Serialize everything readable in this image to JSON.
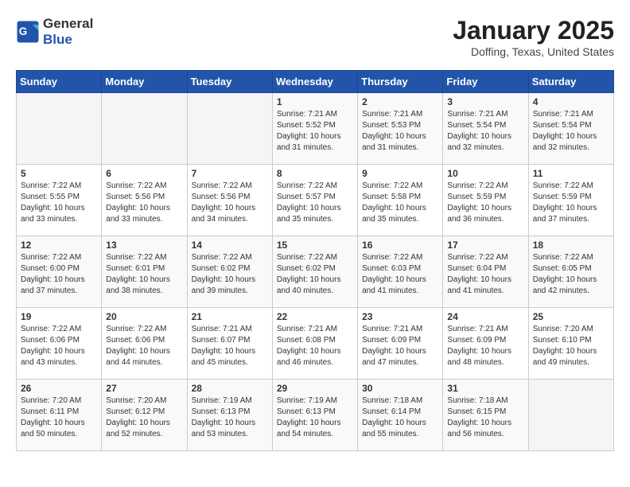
{
  "header": {
    "logo_general": "General",
    "logo_blue": "Blue",
    "title": "January 2025",
    "subtitle": "Doffing, Texas, United States"
  },
  "calendar": {
    "days_of_week": [
      "Sunday",
      "Monday",
      "Tuesday",
      "Wednesday",
      "Thursday",
      "Friday",
      "Saturday"
    ],
    "weeks": [
      [
        {
          "day": "",
          "sunrise": "",
          "sunset": "",
          "daylight": ""
        },
        {
          "day": "",
          "sunrise": "",
          "sunset": "",
          "daylight": ""
        },
        {
          "day": "",
          "sunrise": "",
          "sunset": "",
          "daylight": ""
        },
        {
          "day": "1",
          "sunrise": "Sunrise: 7:21 AM",
          "sunset": "Sunset: 5:52 PM",
          "daylight": "Daylight: 10 hours and 31 minutes."
        },
        {
          "day": "2",
          "sunrise": "Sunrise: 7:21 AM",
          "sunset": "Sunset: 5:53 PM",
          "daylight": "Daylight: 10 hours and 31 minutes."
        },
        {
          "day": "3",
          "sunrise": "Sunrise: 7:21 AM",
          "sunset": "Sunset: 5:54 PM",
          "daylight": "Daylight: 10 hours and 32 minutes."
        },
        {
          "day": "4",
          "sunrise": "Sunrise: 7:21 AM",
          "sunset": "Sunset: 5:54 PM",
          "daylight": "Daylight: 10 hours and 32 minutes."
        }
      ],
      [
        {
          "day": "5",
          "sunrise": "Sunrise: 7:22 AM",
          "sunset": "Sunset: 5:55 PM",
          "daylight": "Daylight: 10 hours and 33 minutes."
        },
        {
          "day": "6",
          "sunrise": "Sunrise: 7:22 AM",
          "sunset": "Sunset: 5:56 PM",
          "daylight": "Daylight: 10 hours and 33 minutes."
        },
        {
          "day": "7",
          "sunrise": "Sunrise: 7:22 AM",
          "sunset": "Sunset: 5:56 PM",
          "daylight": "Daylight: 10 hours and 34 minutes."
        },
        {
          "day": "8",
          "sunrise": "Sunrise: 7:22 AM",
          "sunset": "Sunset: 5:57 PM",
          "daylight": "Daylight: 10 hours and 35 minutes."
        },
        {
          "day": "9",
          "sunrise": "Sunrise: 7:22 AM",
          "sunset": "Sunset: 5:58 PM",
          "daylight": "Daylight: 10 hours and 35 minutes."
        },
        {
          "day": "10",
          "sunrise": "Sunrise: 7:22 AM",
          "sunset": "Sunset: 5:59 PM",
          "daylight": "Daylight: 10 hours and 36 minutes."
        },
        {
          "day": "11",
          "sunrise": "Sunrise: 7:22 AM",
          "sunset": "Sunset: 5:59 PM",
          "daylight": "Daylight: 10 hours and 37 minutes."
        }
      ],
      [
        {
          "day": "12",
          "sunrise": "Sunrise: 7:22 AM",
          "sunset": "Sunset: 6:00 PM",
          "daylight": "Daylight: 10 hours and 37 minutes."
        },
        {
          "day": "13",
          "sunrise": "Sunrise: 7:22 AM",
          "sunset": "Sunset: 6:01 PM",
          "daylight": "Daylight: 10 hours and 38 minutes."
        },
        {
          "day": "14",
          "sunrise": "Sunrise: 7:22 AM",
          "sunset": "Sunset: 6:02 PM",
          "daylight": "Daylight: 10 hours and 39 minutes."
        },
        {
          "day": "15",
          "sunrise": "Sunrise: 7:22 AM",
          "sunset": "Sunset: 6:02 PM",
          "daylight": "Daylight: 10 hours and 40 minutes."
        },
        {
          "day": "16",
          "sunrise": "Sunrise: 7:22 AM",
          "sunset": "Sunset: 6:03 PM",
          "daylight": "Daylight: 10 hours and 41 minutes."
        },
        {
          "day": "17",
          "sunrise": "Sunrise: 7:22 AM",
          "sunset": "Sunset: 6:04 PM",
          "daylight": "Daylight: 10 hours and 41 minutes."
        },
        {
          "day": "18",
          "sunrise": "Sunrise: 7:22 AM",
          "sunset": "Sunset: 6:05 PM",
          "daylight": "Daylight: 10 hours and 42 minutes."
        }
      ],
      [
        {
          "day": "19",
          "sunrise": "Sunrise: 7:22 AM",
          "sunset": "Sunset: 6:06 PM",
          "daylight": "Daylight: 10 hours and 43 minutes."
        },
        {
          "day": "20",
          "sunrise": "Sunrise: 7:22 AM",
          "sunset": "Sunset: 6:06 PM",
          "daylight": "Daylight: 10 hours and 44 minutes."
        },
        {
          "day": "21",
          "sunrise": "Sunrise: 7:21 AM",
          "sunset": "Sunset: 6:07 PM",
          "daylight": "Daylight: 10 hours and 45 minutes."
        },
        {
          "day": "22",
          "sunrise": "Sunrise: 7:21 AM",
          "sunset": "Sunset: 6:08 PM",
          "daylight": "Daylight: 10 hours and 46 minutes."
        },
        {
          "day": "23",
          "sunrise": "Sunrise: 7:21 AM",
          "sunset": "Sunset: 6:09 PM",
          "daylight": "Daylight: 10 hours and 47 minutes."
        },
        {
          "day": "24",
          "sunrise": "Sunrise: 7:21 AM",
          "sunset": "Sunset: 6:09 PM",
          "daylight": "Daylight: 10 hours and 48 minutes."
        },
        {
          "day": "25",
          "sunrise": "Sunrise: 7:20 AM",
          "sunset": "Sunset: 6:10 PM",
          "daylight": "Daylight: 10 hours and 49 minutes."
        }
      ],
      [
        {
          "day": "26",
          "sunrise": "Sunrise: 7:20 AM",
          "sunset": "Sunset: 6:11 PM",
          "daylight": "Daylight: 10 hours and 50 minutes."
        },
        {
          "day": "27",
          "sunrise": "Sunrise: 7:20 AM",
          "sunset": "Sunset: 6:12 PM",
          "daylight": "Daylight: 10 hours and 52 minutes."
        },
        {
          "day": "28",
          "sunrise": "Sunrise: 7:19 AM",
          "sunset": "Sunset: 6:13 PM",
          "daylight": "Daylight: 10 hours and 53 minutes."
        },
        {
          "day": "29",
          "sunrise": "Sunrise: 7:19 AM",
          "sunset": "Sunset: 6:13 PM",
          "daylight": "Daylight: 10 hours and 54 minutes."
        },
        {
          "day": "30",
          "sunrise": "Sunrise: 7:18 AM",
          "sunset": "Sunset: 6:14 PM",
          "daylight": "Daylight: 10 hours and 55 minutes."
        },
        {
          "day": "31",
          "sunrise": "Sunrise: 7:18 AM",
          "sunset": "Sunset: 6:15 PM",
          "daylight": "Daylight: 10 hours and 56 minutes."
        },
        {
          "day": "",
          "sunrise": "",
          "sunset": "",
          "daylight": ""
        }
      ]
    ]
  }
}
